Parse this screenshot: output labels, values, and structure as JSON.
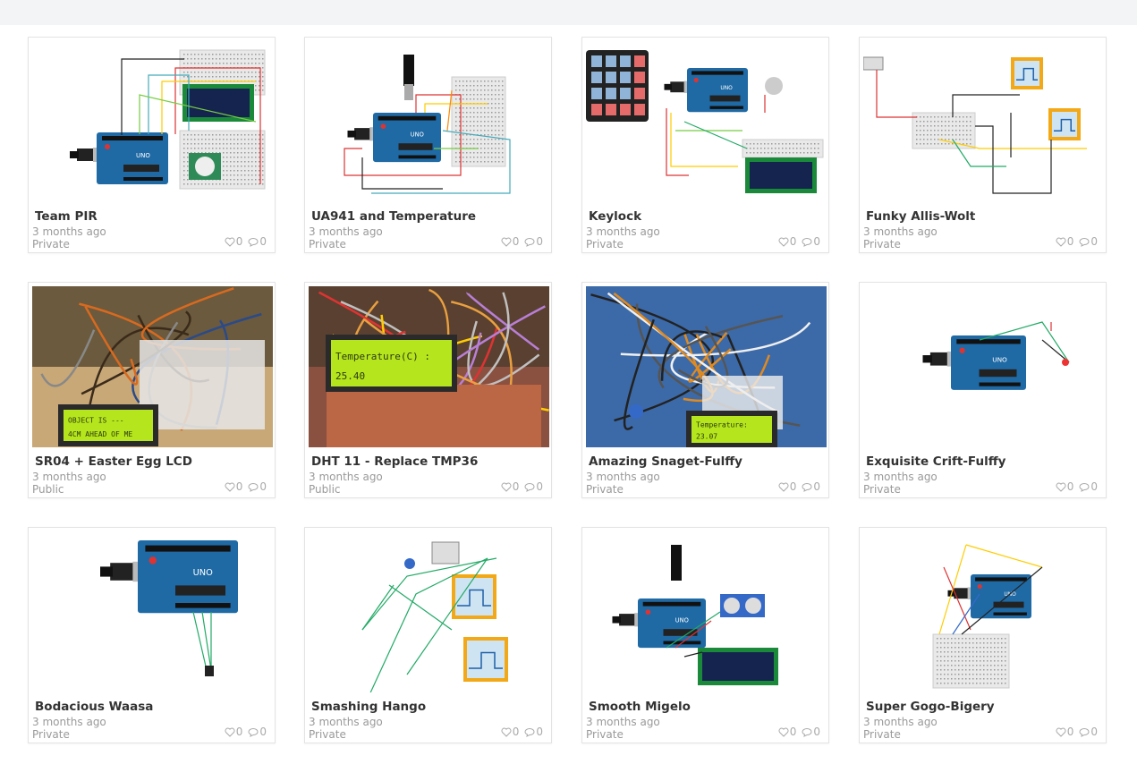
{
  "projects": [
    {
      "title": "Team PIR",
      "date": "3 months ago",
      "visibility": "Private",
      "likes": "0",
      "comments": "0",
      "thumb": "circuit-pir"
    },
    {
      "title": "UA941 and Temperature",
      "date": "3 months ago",
      "visibility": "Private",
      "likes": "0",
      "comments": "0",
      "thumb": "circuit-temp"
    },
    {
      "title": "Keylock",
      "date": "3 months ago",
      "visibility": "Private",
      "likes": "0",
      "comments": "0",
      "thumb": "circuit-keypad"
    },
    {
      "title": "Funky Allis-Wolt",
      "date": "3 months ago",
      "visibility": "Private",
      "likes": "0",
      "comments": "0",
      "thumb": "circuit-scope"
    },
    {
      "title": "SR04 + Easter Egg LCD",
      "date": "3 months ago",
      "visibility": "Public",
      "likes": "0",
      "comments": "0",
      "thumb": "photo-sr04",
      "lcd": [
        "OBJECT IS ---",
        "4CM AHEAD OF ME"
      ]
    },
    {
      "title": "DHT 11 - Replace TMP36",
      "date": "3 months ago",
      "visibility": "Public",
      "likes": "0",
      "comments": "0",
      "thumb": "photo-dht",
      "lcd": [
        "Temperature(C) :",
        "25.40"
      ]
    },
    {
      "title": "Amazing Snaget-Fulffy",
      "date": "3 months ago",
      "visibility": "Private",
      "likes": "0",
      "comments": "0",
      "thumb": "photo-snaget",
      "lcd": [
        "Temperature:",
        "23.07"
      ]
    },
    {
      "title": "Exquisite Crift-Fulffy",
      "date": "3 months ago",
      "visibility": "Private",
      "likes": "0",
      "comments": "0",
      "thumb": "circuit-uno-led"
    },
    {
      "title": "Bodacious Waasa",
      "date": "3 months ago",
      "visibility": "Private",
      "likes": "0",
      "comments": "0",
      "thumb": "circuit-uno-sensor"
    },
    {
      "title": "Smashing Hango",
      "date": "3 months ago",
      "visibility": "Private",
      "likes": "0",
      "comments": "0",
      "thumb": "circuit-scopes"
    },
    {
      "title": "Smooth Migelo",
      "date": "3 months ago",
      "visibility": "Private",
      "likes": "0",
      "comments": "0",
      "thumb": "circuit-ultrasonic"
    },
    {
      "title": "Super Gogo-Bigery",
      "date": "3 months ago",
      "visibility": "Private",
      "likes": "0",
      "comments": "0",
      "thumb": "circuit-breadboard"
    }
  ],
  "icons": {
    "like": "heart-icon",
    "comment": "comment-icon"
  },
  "colors": {
    "arduino": "#1f6aa5",
    "lcd_green": "#b5e61d",
    "title": "#333333",
    "meta": "#9a9a9a"
  }
}
